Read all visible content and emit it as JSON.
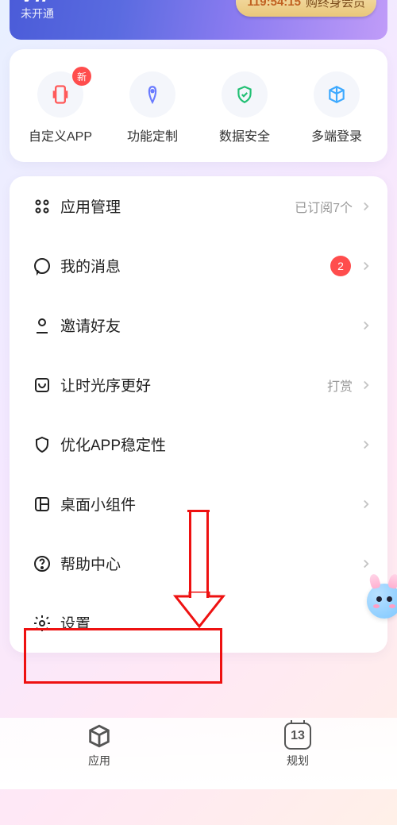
{
  "vip": {
    "logo": "VIP",
    "status": "未开通",
    "countdown": "119:54:15",
    "cta": "购终身会员"
  },
  "shortcuts": [
    {
      "label": "自定义APP",
      "icon": "phone-icon",
      "badge": "新",
      "color": "#ff5a5a"
    },
    {
      "label": "功能定制",
      "icon": "pen-icon",
      "color": "#6a7bff"
    },
    {
      "label": "数据安全",
      "icon": "shield-check-icon",
      "color": "#22c074"
    },
    {
      "label": "多端登录",
      "icon": "cube-icon",
      "color": "#3da9ff"
    }
  ],
  "menu": [
    {
      "icon": "grid-icon",
      "title": "应用管理",
      "trail": "已订阅7个"
    },
    {
      "icon": "chat-icon",
      "title": "我的消息",
      "count": "2"
    },
    {
      "icon": "user-icon",
      "title": "邀请好友"
    },
    {
      "icon": "pocket-icon",
      "title": "让时光序更好",
      "trail": "打赏"
    },
    {
      "icon": "shield-icon",
      "title": "优化APP稳定性"
    },
    {
      "icon": "layout-icon",
      "title": "桌面小组件"
    },
    {
      "icon": "help-icon",
      "title": "帮助中心"
    },
    {
      "icon": "gear-icon",
      "title": "设置"
    }
  ],
  "nav": {
    "app": {
      "label": "应用"
    },
    "plan": {
      "label": "规划",
      "day": "13"
    }
  }
}
